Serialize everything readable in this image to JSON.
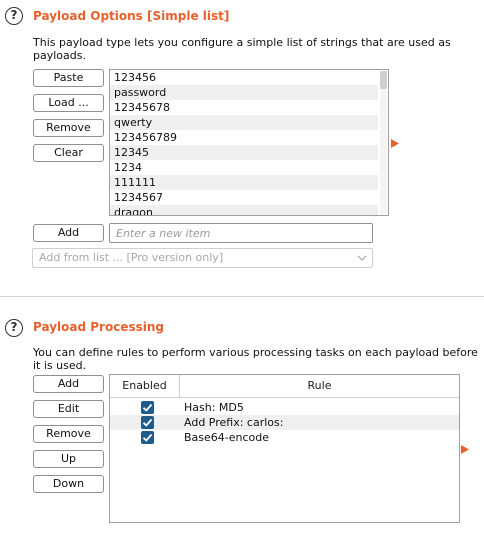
{
  "payload_options": {
    "title": "Payload Options [Simple list]",
    "description": "This payload type lets you configure a simple list of strings that are used as payloads.",
    "buttons": {
      "paste": "Paste",
      "load": "Load ...",
      "remove": "Remove",
      "clear": "Clear",
      "add": "Add"
    },
    "payloads": [
      "123456",
      "password",
      "12345678",
      "qwerty",
      "123456789",
      "12345",
      "1234",
      "111111",
      "1234567",
      "dragon"
    ],
    "add_input": {
      "value": "",
      "placeholder": "Enter a new item"
    },
    "add_from_list": {
      "selected": "Add from list ... [Pro version only]"
    }
  },
  "payload_processing": {
    "title": "Payload Processing",
    "description": "You can define rules to perform various processing tasks on each payload before it is used.",
    "buttons": {
      "add": "Add",
      "edit": "Edit",
      "remove": "Remove",
      "up": "Up",
      "down": "Down"
    },
    "table": {
      "headers": {
        "enabled": "Enabled",
        "rule": "Rule"
      },
      "rows": [
        {
          "enabled": true,
          "rule": "Hash: MD5"
        },
        {
          "enabled": true,
          "rule": "Add Prefix: carlos:"
        },
        {
          "enabled": true,
          "rule": "Base64-encode"
        }
      ]
    }
  },
  "colors": {
    "accent": "#e8612c",
    "checkbox": "#1f5a8c",
    "row_alt": "#efefef"
  },
  "icons": {
    "help": "?",
    "expand_arrow": "orange-right-triangle",
    "dropdown_chevron": "chevron-down"
  }
}
